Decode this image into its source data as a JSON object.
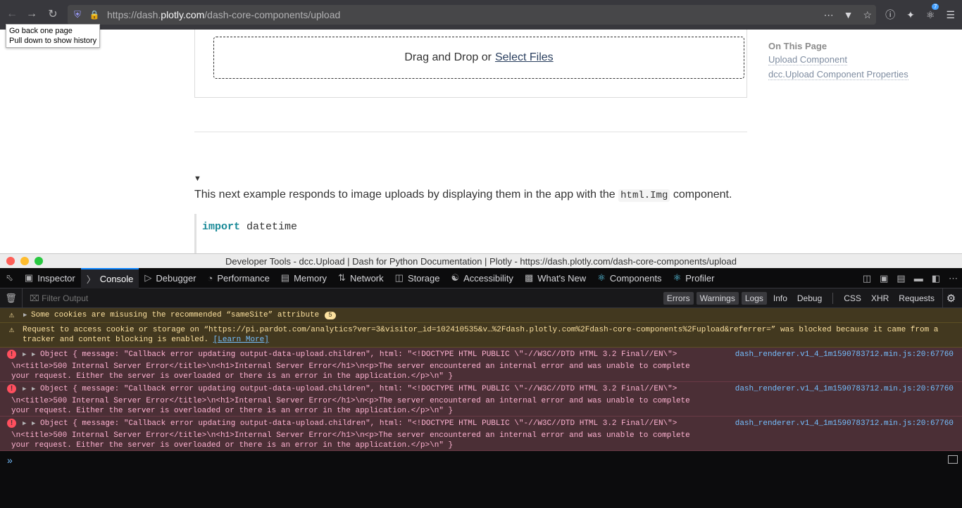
{
  "browser": {
    "url_prefix": "https://dash.",
    "url_host": "plotly.com",
    "url_path": "/dash-core-components/upload",
    "extension_count": "7",
    "tooltip_line1": "Go back one page",
    "tooltip_line2": "Pull down to show history"
  },
  "page": {
    "drop_text": "Drag and Drop or",
    "drop_link": "Select Files",
    "toc_title": "On This Page",
    "toc_links": [
      "Upload Component",
      "dcc.Upload Component Properties"
    ],
    "disclosure": "▼",
    "para_before": "This next example responds to image uploads by displaying them in the app with the",
    "para_code": "html.Img",
    "para_after": "component.",
    "code_kw": "import",
    "code_rest": " datetime"
  },
  "devtools": {
    "window_title": "Developer Tools - dcc.Upload | Dash for Python Documentation | Plotly - https://dash.plotly.com/dash-core-components/upload",
    "tabs": [
      "Inspector",
      "Console",
      "Debugger",
      "Performance",
      "Memory",
      "Network",
      "Storage",
      "Accessibility",
      "What's New",
      "Components",
      "Profiler"
    ],
    "filter_placeholder": "Filter Output",
    "filter_buttons": [
      "Errors",
      "Warnings",
      "Logs",
      "Info",
      "Debug",
      "CSS",
      "XHR",
      "Requests"
    ],
    "messages": {
      "warn1": "Some cookies are misusing the recommended “sameSite” attribute",
      "warn1_count": "5",
      "warn2_line1": "Request to access cookie or storage on “https://pi.pardot.com/analytics?ver=3&visitor_id=102410535&v…%2Fdash.plotly.com%2Fdash-core-components%2Fupload&referrer=” was blocked because it came from a",
      "warn2_line2": "tracker and content blocking is enabled.",
      "warn2_link": "[Learn More]",
      "err_line1": "Object { message: \"Callback error updating output-data-upload.children\", html: \"<!DOCTYPE HTML PUBLIC \\\"-//W3C//DTD HTML 3.2 Final//EN\\\">",
      "err_line2": "\\n<title>500 Internal Server Error</title>\\n<h1>Internal Server Error</h1>\\n<p>The server encountered an internal error and was unable to complete",
      "err_line3": "your request. Either the server is overloaded or there is an error in the application.</p>\\n\" }",
      "err_source": "dash_renderer.v1_4_1m1590783712.min.js:20:67760"
    }
  }
}
